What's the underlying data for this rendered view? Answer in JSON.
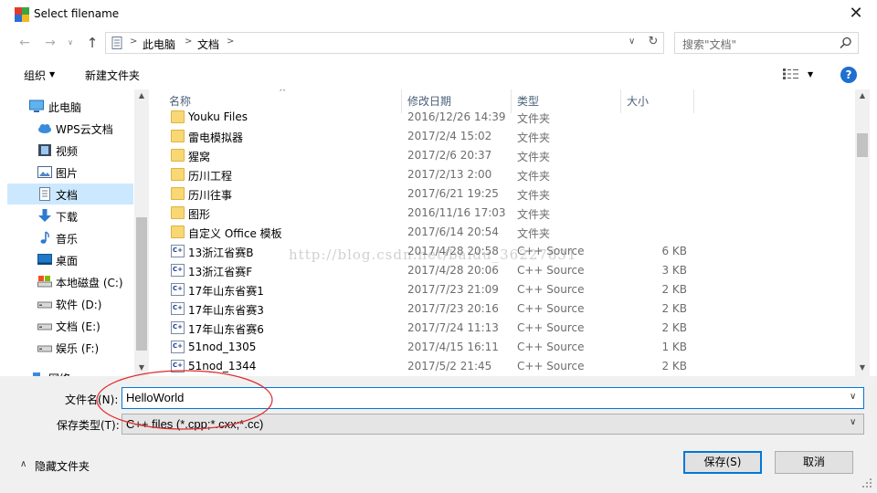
{
  "window": {
    "title": "Select filename",
    "close_symbol": "✕"
  },
  "nav": {
    "back_symbol": "←",
    "forward_symbol": "→",
    "history_symbol": "∨",
    "up_symbol": "↑",
    "address": [
      "此电脑",
      "文档"
    ],
    "search_placeholder": "搜索\"文档\""
  },
  "toolbar": {
    "organize_label": "组织",
    "new_folder_label": "新建文件夹",
    "help_label": "?"
  },
  "sidebar": {
    "items": [
      {
        "label": "此电脑",
        "icon": "computer-icon"
      },
      {
        "label": "WPS云文档",
        "icon": "cloud-icon"
      },
      {
        "label": "视频",
        "icon": "video-icon"
      },
      {
        "label": "图片",
        "icon": "picture-icon"
      },
      {
        "label": "文档",
        "icon": "document-icon",
        "selected": true
      },
      {
        "label": "下载",
        "icon": "download-icon"
      },
      {
        "label": "音乐",
        "icon": "music-icon"
      },
      {
        "label": "桌面",
        "icon": "desktop-icon"
      },
      {
        "label": "本地磁盘 (C:)",
        "icon": "drive-icon"
      },
      {
        "label": "软件 (D:)",
        "icon": "drive-icon"
      },
      {
        "label": "文档 (E:)",
        "icon": "drive-icon"
      },
      {
        "label": "娱乐 (F:)",
        "icon": "drive-icon"
      },
      {
        "label": "网络",
        "icon": "network-icon"
      }
    ]
  },
  "filelist": {
    "columns": {
      "name": "名称",
      "date": "修改日期",
      "type": "类型",
      "size": "大小"
    },
    "rows": [
      {
        "name": "Youku Files",
        "date": "2016/12/26 14:39",
        "type": "文件夹",
        "size": "",
        "kind": "folder"
      },
      {
        "name": "雷电模拟器",
        "date": "2017/2/4 15:02",
        "type": "文件夹",
        "size": "",
        "kind": "folder"
      },
      {
        "name": "猩窝",
        "date": "2017/2/6 20:37",
        "type": "文件夹",
        "size": "",
        "kind": "folder"
      },
      {
        "name": "历川工程",
        "date": "2017/2/13 2:00",
        "type": "文件夹",
        "size": "",
        "kind": "folder"
      },
      {
        "name": "历川往事",
        "date": "2017/6/21 19:25",
        "type": "文件夹",
        "size": "",
        "kind": "folder"
      },
      {
        "name": "图形",
        "date": "2016/11/16 17:03",
        "type": "文件夹",
        "size": "",
        "kind": "folder"
      },
      {
        "name": "自定义 Office 模板",
        "date": "2017/6/14 20:54",
        "type": "文件夹",
        "size": "",
        "kind": "folder"
      },
      {
        "name": "13浙江省赛B",
        "date": "2017/4/28 20:58",
        "type": "C++ Source",
        "size": "6 KB",
        "kind": "cpp"
      },
      {
        "name": "13浙江省赛F",
        "date": "2017/4/28 20:06",
        "type": "C++ Source",
        "size": "3 KB",
        "kind": "cpp"
      },
      {
        "name": "17年山东省赛1",
        "date": "2017/7/23 21:09",
        "type": "C++ Source",
        "size": "2 KB",
        "kind": "cpp"
      },
      {
        "name": "17年山东省赛3",
        "date": "2017/7/23 20:16",
        "type": "C++ Source",
        "size": "2 KB",
        "kind": "cpp"
      },
      {
        "name": "17年山东省赛6",
        "date": "2017/7/24 11:13",
        "type": "C++ Source",
        "size": "2 KB",
        "kind": "cpp"
      },
      {
        "name": "51nod_1305",
        "date": "2017/4/15 16:11",
        "type": "C++ Source",
        "size": "1 KB",
        "kind": "cpp"
      },
      {
        "name": "51nod_1344",
        "date": "2017/5/2 21:45",
        "type": "C++ Source",
        "size": "2 KB",
        "kind": "cpp"
      }
    ]
  },
  "watermark": "http://blog.csdn.net/baidu_36227831",
  "footer": {
    "filename_label": "文件名(N):",
    "filename_value": "HelloWorld",
    "filetype_label": "保存类型(T):",
    "filetype_value": "C++ files (*.cpp;*.cxx;*.cc)",
    "hide_folders_label": "隐藏文件夹",
    "save_label": "保存(S)",
    "cancel_label": "取消"
  },
  "colors": {
    "accent": "#0078d7",
    "selection": "#cce8ff",
    "annotation": "#e0282a",
    "folder": "#f8d775"
  }
}
